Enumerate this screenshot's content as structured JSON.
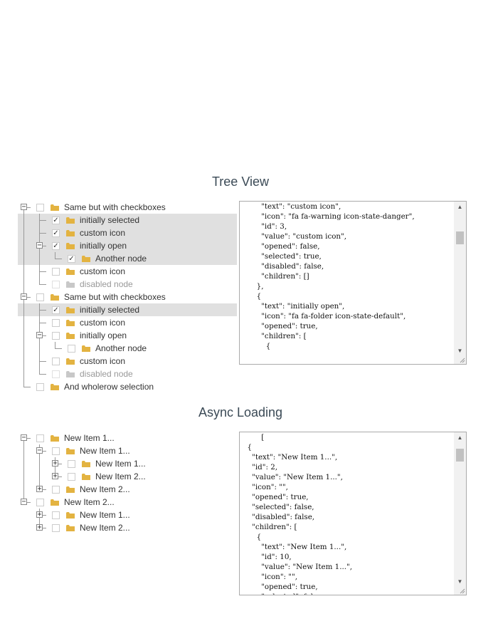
{
  "sections": {
    "tree_view_title": "Tree View",
    "async_title": "Async Loading"
  },
  "tree1": [
    {
      "label": "Same but with checkboxes",
      "depth": 0,
      "toggle": "-",
      "checked": false,
      "selected": false,
      "disabled": false,
      "line_down": true
    },
    {
      "label": "initially selected",
      "depth": 1,
      "toggle": "",
      "checked": true,
      "selected": true,
      "disabled": false
    },
    {
      "label": "custom icon",
      "depth": 1,
      "toggle": "",
      "checked": true,
      "selected": true,
      "disabled": false
    },
    {
      "label": "initially open",
      "depth": 1,
      "toggle": "-",
      "checked": true,
      "selected": true,
      "disabled": false
    },
    {
      "label": "Another node",
      "depth": 2,
      "toggle": "",
      "checked": true,
      "selected": true,
      "disabled": false
    },
    {
      "label": "custom icon",
      "depth": 1,
      "toggle": "",
      "checked": false,
      "selected": false,
      "disabled": false
    },
    {
      "label": "disabled node",
      "depth": 1,
      "toggle": "",
      "checked": false,
      "selected": false,
      "disabled": true
    },
    {
      "label": "Same but with checkboxes",
      "depth": 0,
      "toggle": "-",
      "checked": false,
      "selected": false,
      "disabled": false
    },
    {
      "label": "initially selected",
      "depth": 1,
      "toggle": "",
      "checked": true,
      "selected": true,
      "disabled": false
    },
    {
      "label": "custom icon",
      "depth": 1,
      "toggle": "",
      "checked": false,
      "selected": false,
      "disabled": false
    },
    {
      "label": "initially open",
      "depth": 1,
      "toggle": "-",
      "checked": false,
      "selected": false,
      "disabled": false
    },
    {
      "label": "Another node",
      "depth": 2,
      "toggle": "",
      "checked": false,
      "selected": false,
      "disabled": false
    },
    {
      "label": "custom icon",
      "depth": 1,
      "toggle": "",
      "checked": false,
      "selected": false,
      "disabled": false
    },
    {
      "label": "disabled node",
      "depth": 1,
      "toggle": "",
      "checked": false,
      "selected": false,
      "disabled": true
    },
    {
      "label": "And wholerow selection",
      "depth": 0,
      "toggle": "",
      "checked": false,
      "selected": false,
      "disabled": false,
      "last": true
    }
  ],
  "tree2": [
    {
      "label": "New Item 1...",
      "depth": 0,
      "toggle": "-",
      "checked": false
    },
    {
      "label": "New Item 1...",
      "depth": 1,
      "toggle": "-",
      "checked": false
    },
    {
      "label": "New Item 1...",
      "depth": 2,
      "toggle": "+",
      "checked": false
    },
    {
      "label": "New Item 2...",
      "depth": 2,
      "toggle": "+",
      "checked": false
    },
    {
      "label": "New Item 2...",
      "depth": 1,
      "toggle": "+",
      "checked": false
    },
    {
      "label": "New Item 2...",
      "depth": 0,
      "toggle": "-",
      "checked": false,
      "nobox": true,
      "nofolder": true
    },
    {
      "label": "New Item 1...",
      "depth": 1,
      "toggle": "+",
      "checked": false
    },
    {
      "label": "New Item 2...",
      "depth": 1,
      "toggle": "+",
      "checked": false
    }
  ],
  "json1": "        \"text\": \"custom icon\",\n        \"icon\": \"fa fa-warning icon-state-danger\",\n        \"id\": 3,\n        \"value\": \"custom icon\",\n        \"opened\": false,\n        \"selected\": true,\n        \"disabled\": false,\n        \"children\": []\n      },\n      {\n        \"text\": \"initially open\",\n        \"icon\": \"fa fa-folder icon-state-default\",\n        \"opened\": true,\n        \"children\": [\n          {",
  "json2": "        [\n  {\n    \"text\": \"New Item 1...\",\n    \"id\": 2,\n    \"value\": \"New Item 1...\",\n    \"icon\": \"\",\n    \"opened\": true,\n    \"selected\": false,\n    \"disabled\": false,\n    \"children\": [\n      {\n        \"text\": \"New Item 1...\",\n        \"id\": 10,\n        \"value\": \"New Item 1...\",\n        \"icon\": \"\",\n        \"opened\": true,\n        \"selected\": false",
  "scroll1": {
    "position": 0.16
  },
  "scroll2": {
    "position": 0.05
  },
  "colors": {
    "folder": "#e3b341",
    "folder_disabled": "#c8c8c8",
    "selected_row": "#e0e0e0"
  }
}
